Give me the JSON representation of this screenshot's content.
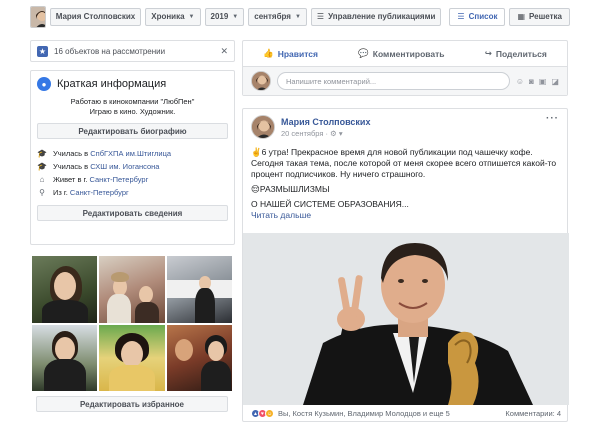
{
  "topbar": {
    "name": "Мария Столповских",
    "chronicle": "Хроника",
    "year": "2019",
    "month": "сентября",
    "manage": "Управление публикациями",
    "list": "Список",
    "grid": "Решетка"
  },
  "review": {
    "text": "16 объектов на рассмотрении"
  },
  "intro": {
    "title": "Краткая информация",
    "bio_line1": "Работаю в кинокомпании \"ЛюбПен\"",
    "bio_line2": "Играю в кино. Художник.",
    "edit_bio": "Редактировать биографию",
    "items": [
      {
        "prefix": "Училась в ",
        "link": "СпбГХПА им.Штиглица"
      },
      {
        "prefix": "Училась в ",
        "link": "СХШ им. Иогансона"
      },
      {
        "prefix": "Живет в г. ",
        "link": "Санкт-Петербург"
      },
      {
        "prefix": "Из г. ",
        "link": "Санкт-Петербург"
      }
    ],
    "edit_info": "Редактировать сведения",
    "edit_featured": "Редактировать избранное"
  },
  "actions": {
    "like": "Нравится",
    "comment": "Комментировать",
    "share": "Поделиться"
  },
  "comment_box": {
    "placeholder": "Напишите комментарий..."
  },
  "post": {
    "author": "Мария Столповских",
    "date": "20 сентября",
    "text1": "✌️6 утра! Прекрасное время для новой публикации под чашечку кофе. Сегодня такая тема, после которой от меня скорее всего отпишется какой-то процент подписчиков. Ну ничего страшного.",
    "text2": "😌РАЗМЫШЛИЗМЫ",
    "text3": "О НАШЕЙ СИСТЕМЕ ОБРАЗОВАНИЯ...",
    "more": "Читать дальше",
    "reactions_text": "Вы, Костя Кузьмин, Владимир Молодцов и еще 5",
    "comments": "Комментарии: 4"
  },
  "colors": {
    "accent": "#4267b2",
    "link": "#385898"
  }
}
